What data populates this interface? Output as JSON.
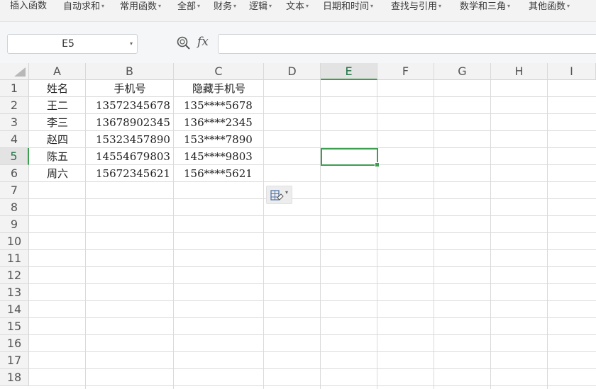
{
  "ribbon": {
    "items": [
      {
        "label": "插入函数",
        "dropdown": false
      },
      {
        "label": "自动求和",
        "dropdown": true
      },
      {
        "label": "常用函数",
        "dropdown": true
      },
      {
        "label": "全部",
        "dropdown": true
      },
      {
        "label": "财务",
        "dropdown": true
      },
      {
        "label": "逻辑",
        "dropdown": true
      },
      {
        "label": "文本",
        "dropdown": true
      },
      {
        "label": "日期和时间",
        "dropdown": true
      },
      {
        "label": "查找与引用",
        "dropdown": true
      },
      {
        "label": "数学和三角",
        "dropdown": true
      },
      {
        "label": "其他函数",
        "dropdown": true
      }
    ],
    "dropdown_glyph": "▾"
  },
  "formula_bar": {
    "name_box": "E5",
    "name_box_caret": "▾",
    "fx_label": "fx",
    "formula_value": "",
    "zoom_icon": "magnifier-icon"
  },
  "sheet": {
    "columns": [
      "A",
      "B",
      "C",
      "D",
      "E",
      "F",
      "G",
      "H",
      "I"
    ],
    "rows": [
      "1",
      "2",
      "3",
      "4",
      "5",
      "6",
      "7",
      "8",
      "9",
      "10",
      "11",
      "12",
      "13",
      "14",
      "15",
      "16",
      "17",
      "18"
    ],
    "active_cell": {
      "column": "E",
      "row": "5"
    },
    "accent_color": "#3c9e4f",
    "cells": {
      "A1": "姓名",
      "B1": "手机号",
      "C1": "隐藏手机号",
      "A2": "王二",
      "B2": "13572345678",
      "C2": "135****5678",
      "A3": "李三",
      "B3": "13678902345",
      "C3": "136****2345",
      "A4": "赵四",
      "B4": "15323457890",
      "C4": "153****7890",
      "A5": "陈五",
      "B5": "14554679803",
      "C5": "145****9803",
      "A6": "周六",
      "B6": "15672345621",
      "C6": "156****5621"
    }
  },
  "paste_options": {
    "icon": "paste-options-icon",
    "caret": "▾"
  }
}
